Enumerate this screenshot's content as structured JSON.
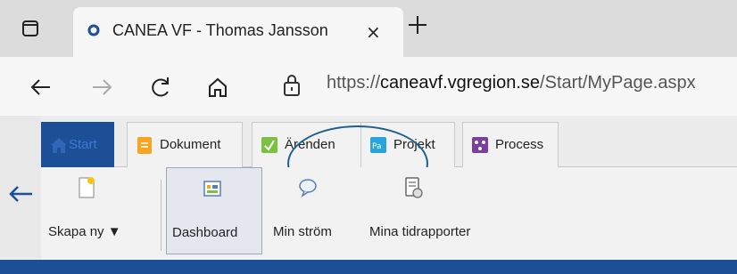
{
  "browser": {
    "tab_title": "CANEA VF - Thomas Jansson",
    "tab_close": "×",
    "url_scheme": "https://",
    "url_host": "caneavf.vgregion.se",
    "url_path": "/Start/MyPage.aspx"
  },
  "app": {
    "module_tabs": [
      {
        "label": "Start",
        "icon": "home-icon",
        "active": true
      },
      {
        "label": "Dokument",
        "icon": "document-icon"
      },
      {
        "label": "Ärenden",
        "icon": "case-icon"
      },
      {
        "label": "Projekt",
        "icon": "project-icon"
      },
      {
        "label": "Process",
        "icon": "process-icon"
      }
    ],
    "toolbar": {
      "create_new": "Skapa ny ▼",
      "dashboard": "Dashboard",
      "my_stream": "Min ström",
      "my_time_reports": "Mina tidrapporter"
    }
  },
  "colors": {
    "brand_blue": "#1d4f96",
    "highlight_ring": "#1e5f92"
  }
}
